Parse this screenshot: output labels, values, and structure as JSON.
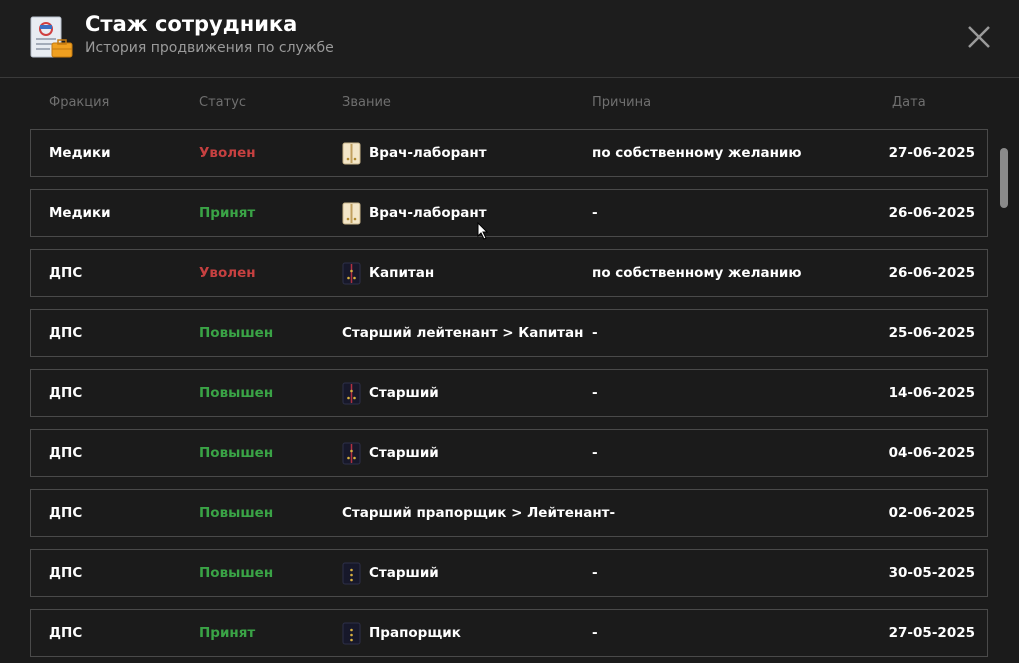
{
  "header": {
    "title": "Стаж сотрудника",
    "subtitle": "История продвижения по службе"
  },
  "columns": {
    "faction": "Фракция",
    "status": "Статус",
    "rank": "Звание",
    "reason": "Причина",
    "date": "Дата"
  },
  "colors": {
    "background": "#1b1b1b",
    "status_fired": "#c64040",
    "status_positive": "#3aa346",
    "muted": "#6f6f6f"
  },
  "rows": [
    {
      "faction": "Медики",
      "status": "Уволен",
      "status_kind": "fired",
      "rank": "Врач-лаборант",
      "rank_icon": "medic-epaulette",
      "reason": "по собственному желанию",
      "date": "27-06-2025"
    },
    {
      "faction": "Медики",
      "status": "Принят",
      "status_kind": "ok",
      "rank": "Врач-лаборант",
      "rank_icon": "medic-epaulette",
      "reason": "-",
      "date": "26-06-2025"
    },
    {
      "faction": "ДПС",
      "status": "Уволен",
      "status_kind": "fired",
      "rank": "Капитан",
      "rank_icon": "police-epaulette-red",
      "reason": "по собственному желанию",
      "date": "26-06-2025"
    },
    {
      "faction": "ДПС",
      "status": "Повышен",
      "status_kind": "ok",
      "rank": "Старший лейтенант > Капитан",
      "rank_icon": "",
      "reason": "-",
      "date": "25-06-2025"
    },
    {
      "faction": "ДПС",
      "status": "Повышен",
      "status_kind": "ok",
      "rank": "Старший",
      "rank_icon": "police-epaulette-red",
      "reason": "-",
      "date": "14-06-2025"
    },
    {
      "faction": "ДПС",
      "status": "Повышен",
      "status_kind": "ok",
      "rank": "Старший",
      "rank_icon": "police-epaulette-red",
      "reason": "-",
      "date": "04-06-2025"
    },
    {
      "faction": "ДПС",
      "status": "Повышен",
      "status_kind": "ok",
      "rank": "Старший прапорщик > Лейтенант-",
      "rank_icon": "",
      "reason": "",
      "date": "02-06-2025"
    },
    {
      "faction": "ДПС",
      "status": "Повышен",
      "status_kind": "ok",
      "rank": "Старший",
      "rank_icon": "police-epaulette-gold",
      "reason": "-",
      "date": "30-05-2025"
    },
    {
      "faction": "ДПС",
      "status": "Принят",
      "status_kind": "ok",
      "rank": "Прапорщик",
      "rank_icon": "police-epaulette-gold",
      "reason": "-",
      "date": "27-05-2025"
    }
  ]
}
